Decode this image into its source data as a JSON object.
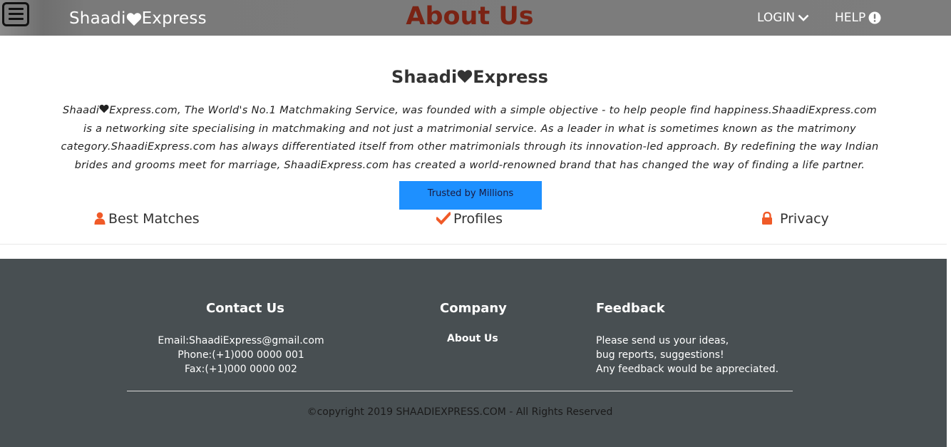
{
  "header": {
    "brand_left": "Shaadi",
    "brand_right": "Express",
    "page_title": "About Us",
    "login_label": "LOGIN",
    "help_label": "HELP"
  },
  "about": {
    "title_left": "Shaadi",
    "title_right": "Express",
    "paragraph_brand": "Shaadi",
    "paragraph": "Express.com, The World's No.1 Matchmaking Service, was founded with a simple objective - to help people find happiness.ShaadiExpress.com is a networking site specialising in matchmaking and not just a matrimonial service. As a leader in what is sometimes known as the matrimony category.ShaadiExpress.com has always differentiated itself from other matrimonials through its innovation-led approach. By redefining the way Indian brides and grooms meet for marriage, ShaadiExpress.com has created a world-renowned brand that has changed the way of finding a life partner.",
    "trusted_button": "Trusted by Millions",
    "features": [
      {
        "label": "Best Matches",
        "icon": "user-icon"
      },
      {
        "label": "Profiles",
        "icon": "check-icon"
      },
      {
        "label": "Privacy",
        "icon": "lock-icon"
      }
    ]
  },
  "footer": {
    "contact": {
      "heading": "Contact Us",
      "email": "Email:ShaadiExpress@gmail.com",
      "phone": "Phone:(+1)000 0000 001",
      "fax": "Fax:(+1)000 0000 002"
    },
    "company": {
      "heading": "Company",
      "link": "About Us"
    },
    "feedback": {
      "heading": "Feedback",
      "line1": "Please send us your ideas,",
      "line2": "bug reports, suggestions!",
      "line3": "Any feedback would be appreciated."
    },
    "copyright": "©copyright 2019 SHAADIEXPRESS.COM - All Rights Reserved"
  },
  "colors": {
    "topbar": "#7d7d7d",
    "title_red": "#7a2314",
    "accent_orange": "#f05a28",
    "button_blue": "#1e90ff",
    "footer_bg": "#484f52"
  }
}
